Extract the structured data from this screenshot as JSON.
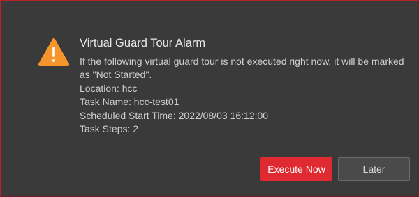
{
  "dialog": {
    "title": "Virtual Guard Tour Alarm",
    "message": "If the following virtual guard tour is not executed right now, it will be marked as \"Not Started\".",
    "location": "Location: hcc",
    "task_name": "Task Name: hcc-test01",
    "scheduled_start": "Scheduled Start Time: 2022/08/03 16:12:00",
    "task_steps": "Task Steps: 2",
    "icon": "warning-icon",
    "buttons": {
      "execute_now": "Execute Now",
      "later": "Later"
    }
  },
  "colors": {
    "background": "#3a3a3a",
    "accent": "#e02a32",
    "warning": "#f7942b",
    "border": "#b8232a"
  }
}
